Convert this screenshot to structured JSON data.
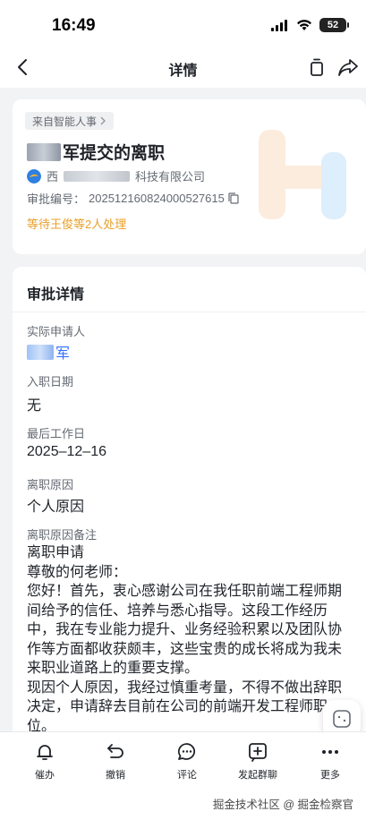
{
  "status_bar": {
    "time": "16:49",
    "battery": "52"
  },
  "nav": {
    "title": "详情",
    "back_icon": "chevron-left-icon",
    "copy_icon": "copy-icon",
    "share_icon": "share-icon"
  },
  "header_card": {
    "source_tag": "来自智能人事",
    "title_suffix": "军提交的离职",
    "company_prefix": "西",
    "company_suffix": "科技有限公司",
    "approval_number_label": "审批编号：",
    "approval_number": "2025121608240005276​15",
    "pending_text": "等待王俊等2人处理"
  },
  "detail": {
    "section_title": "审批详情",
    "fields": [
      {
        "label": "实际申请人",
        "value": "军"
      },
      {
        "label": "入职日期",
        "value": "无"
      },
      {
        "label": "最后工作日",
        "value": "2025–12–16"
      },
      {
        "label": "离职原因",
        "value": "个人原因"
      },
      {
        "label": "离职原因备注",
        "value": ""
      }
    ],
    "note_lines": [
      "离职申请",
      "尊敬的何老师：",
      "您好！首先，衷心感谢公司在我任职前端工程师期间给予的信任、培养与悉心指导。这段工作经历中，我在专业能力提升、业务经验积累以及团队协作等方面都收获颇丰，这些宝贵的成长将成为我未来职业道路上的重要支撑。",
      "现因个人原因，我经过慎重考量，不得不做出辞职决定，申请辞去目前在公司的前端开发工程师职位。"
    ]
  },
  "bottom_actions": [
    {
      "label": "催办",
      "icon": "bell-icon"
    },
    {
      "label": "撤销",
      "icon": "undo-icon"
    },
    {
      "label": "评论",
      "icon": "comment-icon"
    },
    {
      "label": "发起群聊",
      "icon": "group-chat-icon"
    },
    {
      "label": "更多",
      "icon": "more-icon"
    }
  ],
  "watermark": "掘金技术社区 @ 掘金检察官",
  "colors": {
    "accent_blue": "#3370ff",
    "pending_orange": "#e8a02a",
    "background": "#f2f3f5"
  }
}
